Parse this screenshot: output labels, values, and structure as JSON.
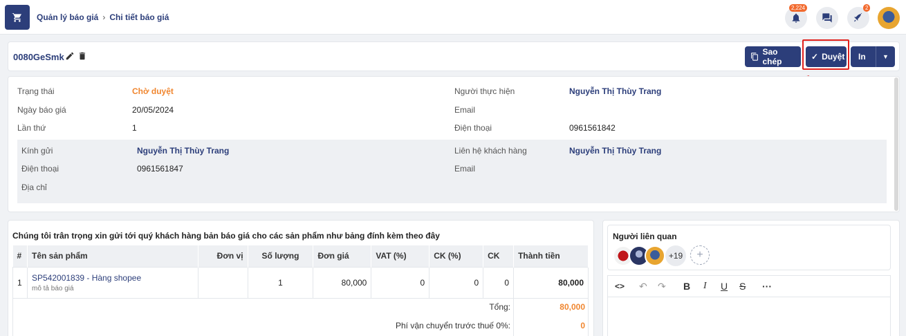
{
  "header": {
    "breadcrumb": [
      "Quản lý báo giá",
      "Chi tiết báo giá"
    ],
    "notifications_count": "2,224",
    "rocket_count": "2"
  },
  "titlebar": {
    "code": "0080GeSmk",
    "copy_label": "Sao chép",
    "approve_label": "Duyệt",
    "print_label": "In"
  },
  "info": {
    "status_label": "Trạng thái",
    "status_value": "Chờ duyệt",
    "date_label": "Ngày báo giá",
    "date_value": "20/05/2024",
    "attempt_label": "Lần thứ",
    "attempt_value": "1",
    "assignee_label": "Người thực hiện",
    "assignee_value": "Nguyễn Thị Thùy Trang",
    "email_label": "Email",
    "email_value": "",
    "phone_label": "Điện thoại",
    "phone_value": "0961561842",
    "to_label": "Kính gửi",
    "to_value": "Nguyễn Thị Thùy Trang",
    "to_phone_label": "Điện thoại",
    "to_phone_value": "0961561847",
    "address_label": "Địa chỉ",
    "address_value": "",
    "contact_label": "Liên hệ khách hàng",
    "contact_value": "Nguyễn Thị Thùy Trang",
    "contact_email_label": "Email",
    "contact_email_value": ""
  },
  "products": {
    "intro": "Chúng tôi trân trọng xin gửi tới quý khách hàng bản báo giá cho các sản phẩm như bảng đính kèm theo đây",
    "columns": [
      "#",
      "Tên sản phẩm",
      "Đơn vị",
      "Số lượng",
      "Đơn giá",
      "VAT (%)",
      "CK (%)",
      "CK",
      "Thành tiền"
    ],
    "rows": [
      {
        "index": "1",
        "name": "SP542001839 - Hàng shopee",
        "desc": "mô tả báo giá",
        "unit": "",
        "qty": "1",
        "price": "80,000",
        "vat": "0",
        "ck_pct": "0",
        "ck": "0",
        "total": "80,000"
      }
    ],
    "total_label": "Tổng:",
    "total_value": "80,000",
    "shipping_label": "Phí vận chuyển trước thuế 0%:",
    "shipping_value": "0"
  },
  "related": {
    "title": "Người liên quan",
    "more_count": "+19"
  },
  "colors": {
    "primary": "#2c3e7a",
    "warning": "#f0862f",
    "highlight": "#e0201b"
  }
}
